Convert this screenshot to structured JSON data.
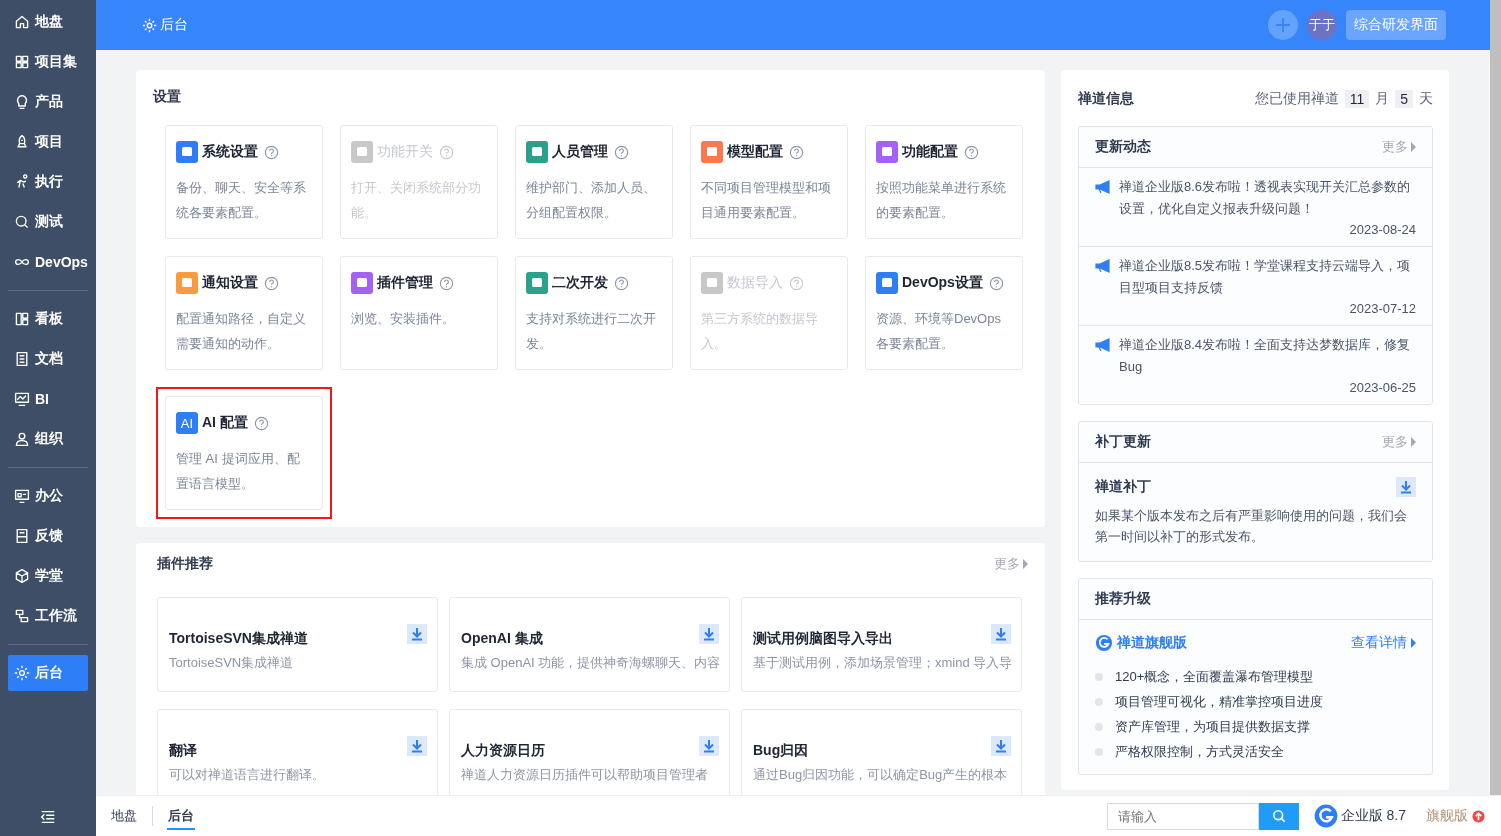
{
  "sidebar": {
    "groups": [
      [
        {
          "label": "地盘",
          "selected": false
        },
        {
          "label": "项目集",
          "selected": false
        },
        {
          "label": "产品",
          "selected": false
        },
        {
          "label": "项目",
          "selected": false
        },
        {
          "label": "执行",
          "selected": false
        },
        {
          "label": "测试",
          "selected": false
        },
        {
          "label": "DevOps",
          "selected": false
        }
      ],
      [
        {
          "label": "看板",
          "selected": false
        },
        {
          "label": "文档",
          "selected": false
        },
        {
          "label": "BI",
          "selected": false
        },
        {
          "label": "组织",
          "selected": false
        }
      ],
      [
        {
          "label": "办公",
          "selected": false
        },
        {
          "label": "反馈",
          "selected": false
        },
        {
          "label": "学堂",
          "selected": false
        },
        {
          "label": "工作流",
          "selected": false
        }
      ],
      [
        {
          "label": "后台",
          "selected": true
        }
      ]
    ]
  },
  "topbar": {
    "title": "后台",
    "avatar": "于于",
    "button": "综合研发界面"
  },
  "settings": {
    "title": "设置",
    "items": [
      {
        "title": "系统设置",
        "description": "备份、聊天、安全等系统各要素配置。",
        "color": "#2e7ff7",
        "disabled": false,
        "highlighted": false
      },
      {
        "title": "功能开关",
        "description": "打开、关闭系统部分功能。",
        "color": "#c8c8c8",
        "disabled": true,
        "highlighted": false
      },
      {
        "title": "人员管理",
        "description": "维护部门、添加人员、分组配置权限。",
        "color": "#2aa18a",
        "disabled": false,
        "highlighted": false
      },
      {
        "title": "模型配置",
        "description": "不同项目管理模型和项目通用要素配置。",
        "color": "#fb7a4d",
        "disabled": false,
        "highlighted": false
      },
      {
        "title": "功能配置",
        "description": "按照功能菜单进行系统的要素配置。",
        "color": "#a560f5",
        "disabled": false,
        "highlighted": false
      },
      {
        "title": "通知设置",
        "description": "配置通知路径，自定义需要通知的动作。",
        "color": "#fd9a3e",
        "disabled": false,
        "highlighted": false
      },
      {
        "title": "插件管理",
        "description": "浏览、安装插件。",
        "color": "#a560f5",
        "disabled": false,
        "highlighted": false
      },
      {
        "title": "二次开发",
        "description": "支持对系统进行二次开发。",
        "color": "#2aa18a",
        "disabled": false,
        "highlighted": false
      },
      {
        "title": "数据导入",
        "description": "第三方系统的数据导入。",
        "color": "#c8c8c8",
        "disabled": true,
        "highlighted": false
      },
      {
        "title": "DevOps设置",
        "description": "资源、环境等DevOps各要素配置。",
        "color": "#2e7ff7",
        "disabled": false,
        "highlighted": false
      },
      {
        "title": "AI 配置",
        "icon_text": "AI",
        "description": "管理 AI 提词应用、配置语言模型。",
        "color": "#2e7ff7",
        "disabled": false,
        "highlighted": true
      }
    ]
  },
  "plugins": {
    "title": "插件推荐",
    "more": "更多",
    "items": [
      {
        "title": "TortoiseSVN集成禅道",
        "description": "TortoiseSVN集成禅道"
      },
      {
        "title": "OpenAI 集成",
        "description": "集成 OpenAI 功能，提供神奇海螺聊天、内容"
      },
      {
        "title": "测试用例脑图导入导出",
        "description": "基于测试用例，添加场景管理；xmind 导入导"
      },
      {
        "title": "翻译",
        "description": "可以对禅道语言进行翻译。"
      },
      {
        "title": "人力资源日历",
        "description": "禅道人力资源日历插件可以帮助项目管理者"
      },
      {
        "title": "Bug归因",
        "description": "通过Bug归因功能，可以确定Bug产生的根本"
      }
    ]
  },
  "info": {
    "title": "禅道信息",
    "usage_prefix": "您已使用禅道",
    "months": "11",
    "month_unit": "月",
    "days": "5",
    "day_unit": "天",
    "updates": {
      "title": "更新动态",
      "more": "更多",
      "items": [
        {
          "text": "禅道企业版8.6发布啦！透视表实现开关汇总参数的设置，优化自定义报表升级问题！",
          "date": "2023-08-24"
        },
        {
          "text": "禅道企业版8.5发布啦！学堂课程支持云端导入，项目型项目支持反馈",
          "date": "2023-07-12"
        },
        {
          "text": "禅道企业版8.4发布啦！全面支持达梦数据库，修复Bug",
          "date": "2023-06-25"
        }
      ]
    },
    "patches": {
      "title": "补丁更新",
      "more": "更多",
      "name": "禅道补丁",
      "description": "如果某个版本发布之后有严重影响使用的问题，我们会第一时间以补丁的形式发布。"
    },
    "upgrade": {
      "title": "推荐升级",
      "product": "禅道旗舰版",
      "details": "查看详情",
      "features": [
        "120+概念，全面覆盖瀑布管理模型",
        "项目管理可视化，精准掌控项目进度",
        "资产库管理，为项目提供数据支撑",
        "严格权限控制，方式灵活安全"
      ]
    }
  },
  "footer": {
    "tabs": [
      {
        "label": "地盘",
        "selected": false
      },
      {
        "label": "后台",
        "selected": true
      }
    ],
    "search": {
      "placeholder": "请输入"
    },
    "edition": "企业版 8.7",
    "upgrade": "旗舰版"
  }
}
